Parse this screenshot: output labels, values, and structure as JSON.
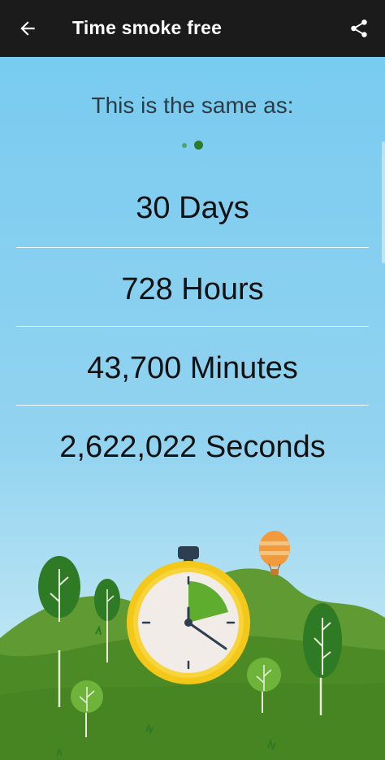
{
  "app_bar": {
    "title": "Time smoke free",
    "back_icon": "arrow-left-icon",
    "share_icon": "share-icon"
  },
  "intro": {
    "heading": "This is the same as:",
    "pager": {
      "count": 2,
      "active_index": 1
    }
  },
  "stats": [
    {
      "label": "30 Days"
    },
    {
      "label": "728 Hours"
    },
    {
      "label": "43,700 Minutes"
    },
    {
      "label": "2,622,022 Seconds"
    }
  ],
  "illustration": {
    "stopwatch_icon": "stopwatch-icon",
    "balloon_icon": "hot-air-balloon-icon",
    "elapsed_fraction": 0.23
  },
  "colors": {
    "app_bar": "#1b1b1b",
    "sky": "#79cbf0",
    "grass": "#4c8a25",
    "accent_green": "#2f7a24",
    "stopwatch_rim": "#f3c818"
  }
}
